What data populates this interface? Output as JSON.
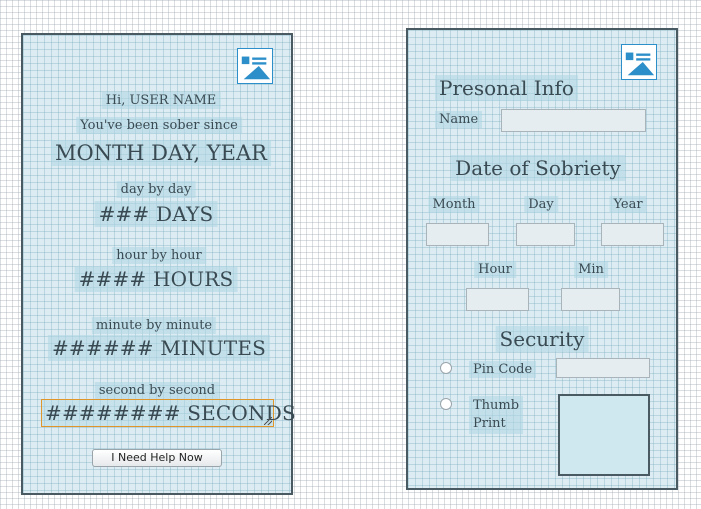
{
  "counter_screen": {
    "greeting": "Hi, USER NAME",
    "sober_since_label": "You've been sober since",
    "date_value": "MONTH DAY, YEAR",
    "days_label": "day by day",
    "days_value": "### DAYS",
    "hours_label": "hour by hour",
    "hours_value": "#### HOURS",
    "minutes_label": "minute by minute",
    "minutes_value": "###### MINUTES",
    "seconds_label": "second by second",
    "seconds_value": "######## SECONDS",
    "help_button": "I Need Help Now",
    "image_icon": "image-placeholder-icon"
  },
  "settings_screen": {
    "personal_info_heading": "Presonal Info",
    "name_label": "Name",
    "name_value": "",
    "sobriety_heading": "Date of Sobriety",
    "month_label": "Month",
    "day_label": "Day",
    "year_label": "Year",
    "hour_label": "Hour",
    "min_label": "Min",
    "security_heading": "Security",
    "pin_code_label": "Pin Code",
    "thumb_print_label_1": "Thumb",
    "thumb_print_label_2": "Print",
    "image_icon": "image-placeholder-icon"
  },
  "colors": {
    "panel_bg": "#dcecf2",
    "panel_border": "#4a5a63",
    "icon_blue": "#2d8fc9",
    "selection_orange": "#e0962a"
  }
}
